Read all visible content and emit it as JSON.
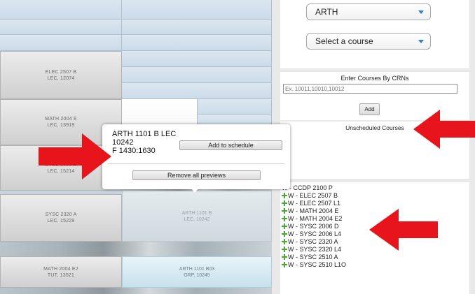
{
  "sidebar": {
    "subject_select": {
      "value": "ARTH"
    },
    "course_select": {
      "value": "Select a course"
    },
    "crn_section": {
      "title": "Enter Courses By CRNs",
      "placeholder": "Ex. 10011,10010,10012",
      "add_label": "Add"
    },
    "unscheduled_title": "Unscheduled Courses",
    "course_list": [
      "W - CCDP 2100 P",
      "W - ELEC 2507 B",
      "W - ELEC 2507 L1",
      "W - MATH 2004 E",
      "W - MATH 2004 E2",
      "W - SYSC 2006 D",
      "W - SYSC 2006 L4",
      "W - SYSC 2320 A",
      "W - SYSC 2320 L4",
      "W - SYSC 2510 A",
      "W - SYSC 2510 L1O"
    ]
  },
  "schedule": {
    "blocks": [
      {
        "line1": "ELEC 2507 B",
        "line2": "LEC, 12074"
      },
      {
        "line1": "MATH 2004 E",
        "line2": "LEC, 13919"
      },
      {
        "line1": "SYSC 2006 D",
        "line2": "LEC, 15214"
      },
      {
        "line1": "SYSC 2320 A",
        "line2": "LEC, 15229"
      },
      {
        "line1": "ARTH 1101 B",
        "line2": "LEC, 10242"
      },
      {
        "line1": "MATH 2004 E2",
        "line2": "TUT, 13521"
      },
      {
        "line1": "ARTH 1101 B03",
        "line2": "GRP, 10245"
      }
    ]
  },
  "popup": {
    "course_title": "ARTH 1101 B LEC",
    "crn": "10242",
    "time": "F 1430:1630",
    "add_label": "Add to schedule",
    "remove_label": "Remove all previews"
  },
  "colors": {
    "arrow": "#e8141b",
    "add_icon": "#49a832",
    "select_caret": "#2a7fd0"
  }
}
